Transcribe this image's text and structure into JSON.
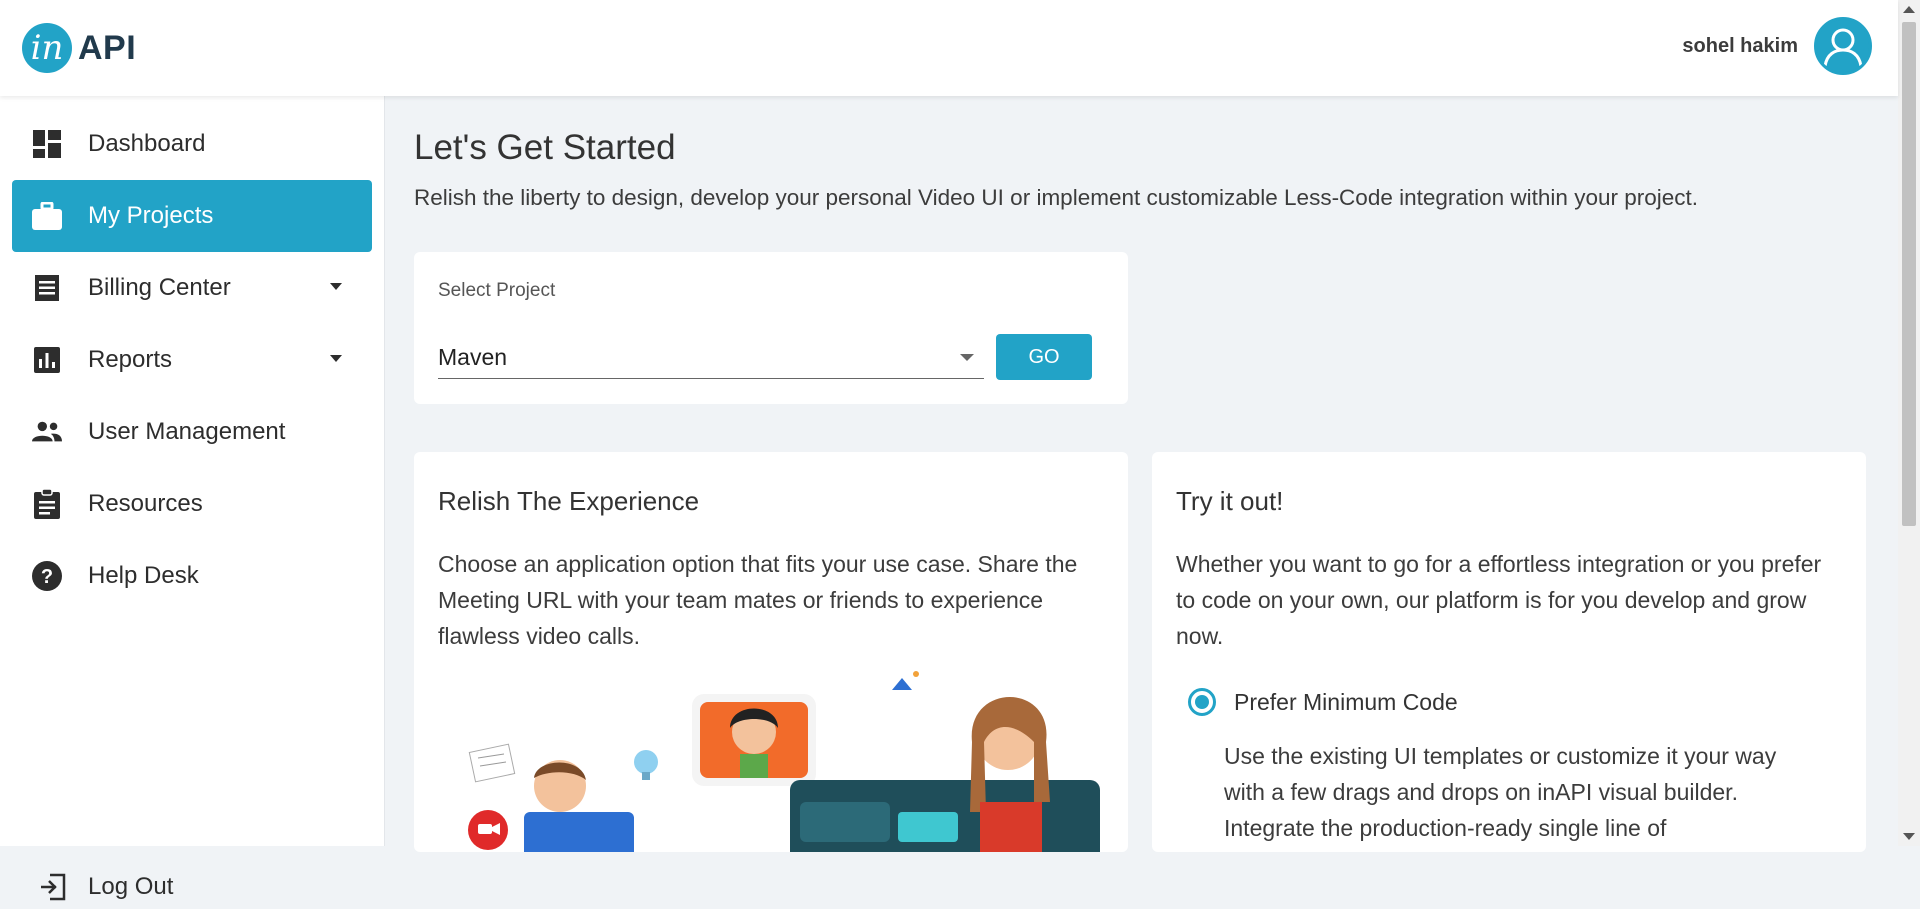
{
  "header": {
    "logo_mark": "in",
    "logo_text": "API",
    "user_name": "sohel hakim"
  },
  "sidebar": {
    "items": [
      {
        "label": "Dashboard",
        "icon": "dashboard-icon"
      },
      {
        "label": "My Projects",
        "icon": "briefcase-icon",
        "active": true
      },
      {
        "label": "Billing Center",
        "icon": "receipt-icon",
        "has_dropdown": true
      },
      {
        "label": "Reports",
        "icon": "bar-chart-icon",
        "has_dropdown": true
      },
      {
        "label": "User Management",
        "icon": "people-icon"
      },
      {
        "label": "Resources",
        "icon": "clipboard-icon"
      },
      {
        "label": "Help Desk",
        "icon": "help-icon"
      }
    ],
    "logout_label": "Log Out"
  },
  "main": {
    "title": "Let's Get Started",
    "subtitle": "Relish the liberty to design, develop your personal Video UI or implement customizable Less-Code integration within your project.",
    "select_project": {
      "label": "Select Project",
      "value": "Maven",
      "go_label": "GO"
    },
    "experience_card": {
      "title": "Relish The Experience",
      "text": "Choose an application option that fits your use case. Share the Meeting URL with your team mates or friends to experience flawless video calls."
    },
    "try_card": {
      "title": "Try it out!",
      "text": "Whether you want to go for a effortless integration or you prefer to code on your own, our platform is for you develop and grow now.",
      "option_label": "Prefer Minimum Code",
      "option_selected": true,
      "option_desc": "Use the existing UI templates or customize it your way with a few drags and drops on inAPI visual builder. Integrate the production-ready single line of"
    }
  },
  "colors": {
    "accent": "#22a3c7",
    "background": "#f0f3f6",
    "text": "#3c3c3c"
  }
}
